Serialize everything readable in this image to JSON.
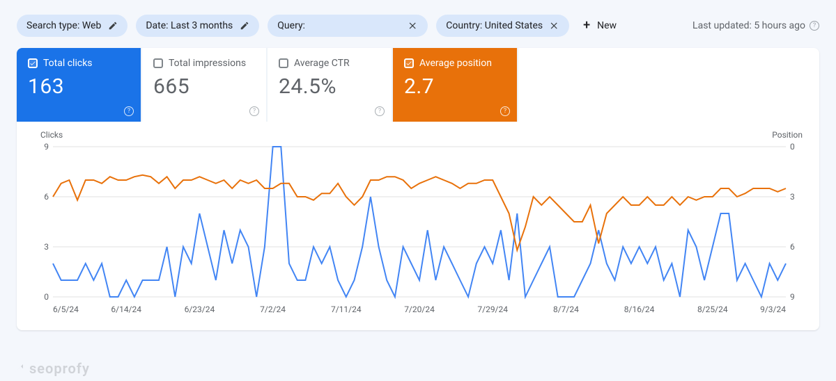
{
  "filters": {
    "search_type_label": "Search type: Web",
    "date_label": "Date: Last 3 months",
    "query_label": "Query:",
    "country_label": "Country: United States",
    "new_label": "New"
  },
  "header": {
    "last_updated": "Last updated: 5 hours ago"
  },
  "metrics": {
    "clicks_label": "Total clicks",
    "clicks_value": "163",
    "impressions_label": "Total impressions",
    "impressions_value": "665",
    "ctr_label": "Average CTR",
    "ctr_value": "24.5%",
    "position_label": "Average position",
    "position_value": "2.7"
  },
  "chart": {
    "left_axis": "Clicks",
    "right_axis": "Position"
  },
  "watermark": "seoprofy",
  "chart_data": {
    "type": "line",
    "title": "",
    "x_categories": [
      "6/5/24",
      "6/14/24",
      "6/23/24",
      "7/2/24",
      "7/11/24",
      "7/20/24",
      "7/29/24",
      "8/7/24",
      "8/16/24",
      "8/25/24",
      "9/3/24"
    ],
    "y_left": {
      "label": "Clicks",
      "ticks": [
        0,
        3,
        6,
        9
      ],
      "range": [
        0,
        9
      ]
    },
    "y_right": {
      "label": "Position",
      "ticks": [
        0,
        3,
        6,
        9
      ],
      "range": [
        0,
        9
      ],
      "inverted": true
    },
    "series": [
      {
        "name": "Total clicks",
        "axis": "left",
        "color": "#4285f4",
        "values": [
          2,
          1,
          1,
          1,
          2,
          1,
          2,
          0,
          0,
          1,
          0,
          1,
          1,
          1,
          3,
          0,
          3,
          2,
          5,
          3,
          1,
          4,
          2,
          4,
          3,
          0,
          3,
          9,
          9,
          2,
          1,
          1,
          3,
          2,
          3,
          1,
          0,
          1,
          3,
          6,
          3,
          1,
          0,
          3,
          2,
          1,
          4,
          1,
          3,
          2,
          1,
          0,
          2,
          3,
          2,
          4,
          1,
          5,
          0,
          1,
          2,
          3,
          0,
          0,
          0,
          1,
          2,
          4,
          2,
          1,
          3,
          2,
          3,
          2,
          3,
          1,
          2,
          0,
          4,
          3,
          1,
          3,
          5,
          5,
          1,
          2,
          1,
          0,
          2,
          1,
          2
        ]
      },
      {
        "name": "Average position",
        "axis": "right",
        "color": "#e8710a",
        "values": [
          3.0,
          2.2,
          2.0,
          3.2,
          2.0,
          2.0,
          2.2,
          1.8,
          2.0,
          2.0,
          1.8,
          1.7,
          1.8,
          2.2,
          1.8,
          2.5,
          2.0,
          2.0,
          1.8,
          2.0,
          2.2,
          2.0,
          2.5,
          2.0,
          2.2,
          2.0,
          2.5,
          2.5,
          2.2,
          2.2,
          3.0,
          3.0,
          3.2,
          2.8,
          2.8,
          2.2,
          3.0,
          3.5,
          3.0,
          2.0,
          2.0,
          1.8,
          1.8,
          2.0,
          2.5,
          2.2,
          2.0,
          1.8,
          2.0,
          2.2,
          2.5,
          2.2,
          2.2,
          2.0,
          2.0,
          3.0,
          4.0,
          6.2,
          4.8,
          3.0,
          3.5,
          3.0,
          3.5,
          4.0,
          4.5,
          4.5,
          3.5,
          5.8,
          4.0,
          3.5,
          3.0,
          3.5,
          3.5,
          3.0,
          3.5,
          3.5,
          3.0,
          3.5,
          3.0,
          3.2,
          3.0,
          3.0,
          2.5,
          2.5,
          3.0,
          2.8,
          2.5,
          2.5,
          2.5,
          2.7,
          2.5
        ]
      }
    ]
  }
}
